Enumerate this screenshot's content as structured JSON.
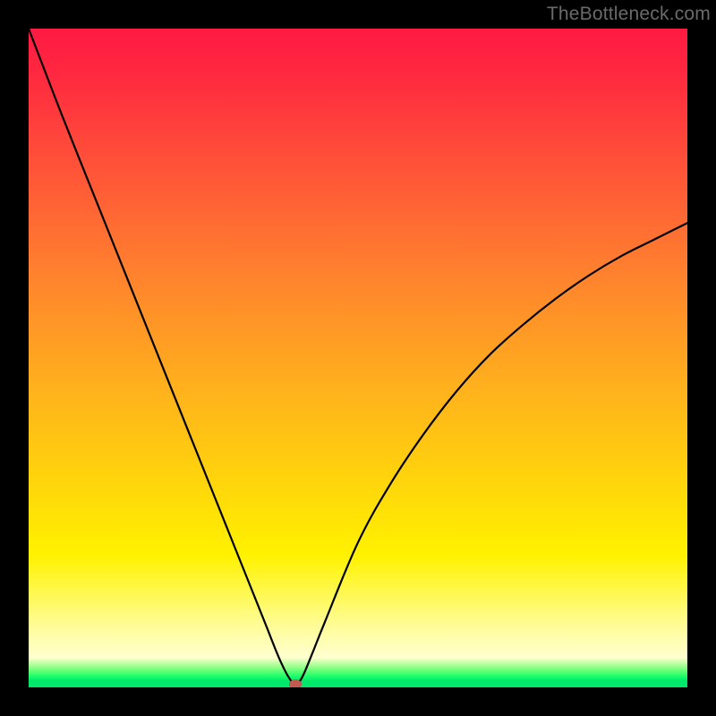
{
  "watermark": "TheBottleneck.com",
  "chart_data": {
    "type": "line",
    "title": "",
    "xlabel": "",
    "ylabel": "",
    "xlim": [
      0,
      100
    ],
    "ylim": [
      0,
      100
    ],
    "x": [
      0,
      5,
      10,
      15,
      20,
      25,
      30,
      33,
      36,
      38,
      39.5,
      40.5,
      41.5,
      43,
      45,
      50,
      55,
      60,
      65,
      70,
      75,
      80,
      85,
      90,
      95,
      100
    ],
    "y": [
      100,
      87,
      74.5,
      62,
      49.5,
      37,
      24.5,
      17,
      9.5,
      4.5,
      1.5,
      0.5,
      1.5,
      5,
      10,
      22,
      31,
      38.5,
      45,
      50.5,
      55,
      59,
      62.5,
      65.5,
      68,
      70.5
    ],
    "minimum_marker": {
      "x": 40.5,
      "y": 0.5
    },
    "marker_color": "#c45a52",
    "gradient_stops": [
      {
        "pos": 0.0,
        "color": "#ff1a42"
      },
      {
        "pos": 0.36,
        "color": "#ff7e2f"
      },
      {
        "pos": 0.7,
        "color": "#ffd80a"
      },
      {
        "pos": 0.95,
        "color": "#ffffd0"
      },
      {
        "pos": 1.0,
        "color": "#00e86b"
      }
    ]
  }
}
